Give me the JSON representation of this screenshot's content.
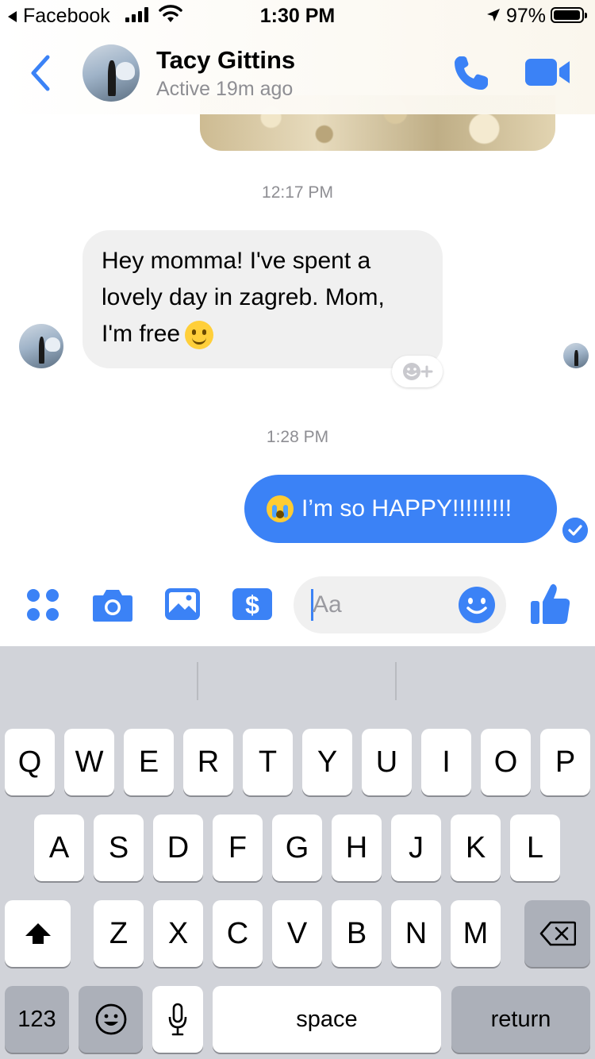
{
  "status_bar": {
    "back_app": "Facebook",
    "time": "1:30 PM",
    "battery_percent": "97%",
    "battery_level": 0.97,
    "signal_bars": 4
  },
  "header": {
    "contact_name": "Tacy Gittins",
    "active_status": "Active 19m ago",
    "accent_color": "#3b82f6"
  },
  "messages": [
    {
      "timestamp": "12:17 PM"
    },
    {
      "from": "contact",
      "lines": [
        "Hey momma! I've spent a",
        "lovely day in zagreb. Mom,",
        "I'm free"
      ],
      "emoji": "slightly-smiling-face"
    },
    {
      "timestamp": "1:28 PM"
    },
    {
      "from": "me",
      "text": "I’m so HAPPY!!!!!!!!!",
      "emoji": "loudly-crying-face",
      "status": "delivered"
    }
  ],
  "composer": {
    "placeholder": "Aa",
    "value": ""
  },
  "keyboard": {
    "row1": [
      "Q",
      "W",
      "E",
      "R",
      "T",
      "Y",
      "U",
      "I",
      "O",
      "P"
    ],
    "row2": [
      "A",
      "S",
      "D",
      "F",
      "G",
      "H",
      "J",
      "K",
      "L"
    ],
    "row3": [
      "Z",
      "X",
      "C",
      "V",
      "B",
      "N",
      "M"
    ],
    "numbers_key": "123",
    "space_key": "space",
    "return_key": "return"
  }
}
